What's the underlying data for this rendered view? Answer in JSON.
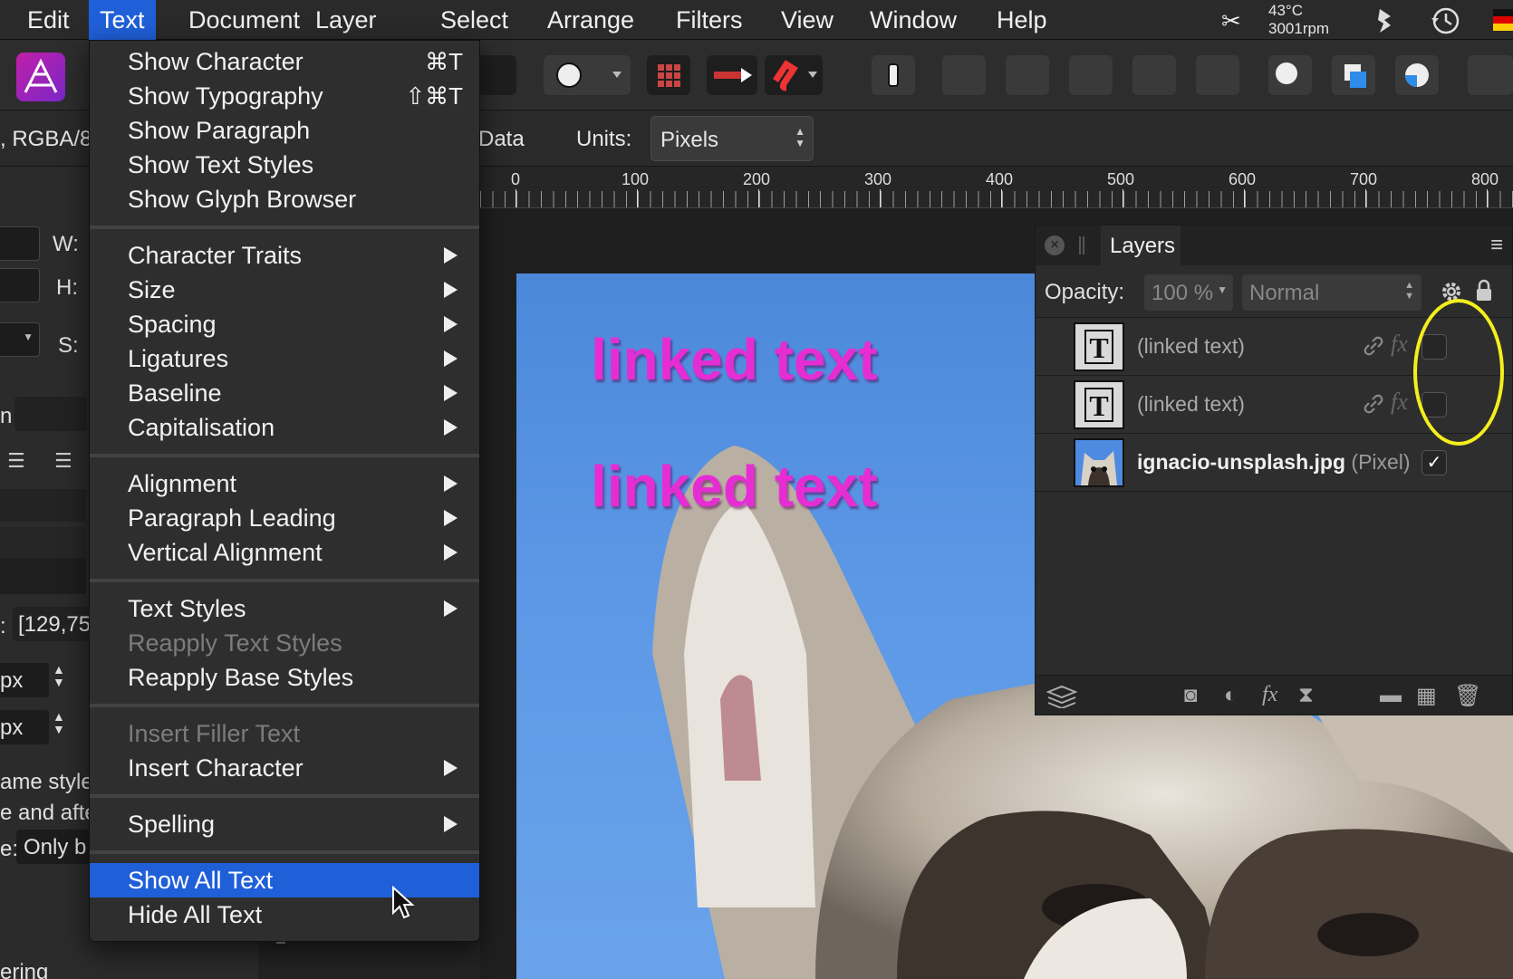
{
  "menubar": {
    "items": [
      "Edit",
      "Text",
      "Document",
      "Layer",
      "Select",
      "Arrange",
      "Filters",
      "View",
      "Window",
      "Help"
    ],
    "active": "Text",
    "temp": "43°C",
    "rpm": "3001rpm"
  },
  "contextbar": {
    "left_text": ", RGBA/8",
    "data_label": "Data",
    "units_label": "Units:",
    "units_value": "Pixels"
  },
  "ruler": {
    "labels": [
      "0",
      "100",
      "200",
      "300",
      "400",
      "500",
      "600",
      "700",
      "800"
    ]
  },
  "leftpanel": {
    "w_label": "W:",
    "h_label": "H:",
    "s_label": "S:",
    "n_label": "n",
    "coord_value": "[129,75",
    "coord_prefix": ":",
    "px1": "px",
    "px2": "px",
    "line1": "ame styles",
    "line2": "e and afte",
    "line3_prefix": "e:",
    "line3_value": "Only b",
    "bottom_text": "ering"
  },
  "text_menu": {
    "groups": [
      [
        {
          "label": "Show Character",
          "shortcut": "⌘T"
        },
        {
          "label": "Show Typography",
          "shortcut": "⇧⌘T"
        },
        {
          "label": "Show Paragraph"
        },
        {
          "label": "Show Text Styles"
        },
        {
          "label": "Show Glyph Browser"
        }
      ],
      [
        {
          "label": "Character Traits",
          "submenu": true
        },
        {
          "label": "Size",
          "submenu": true
        },
        {
          "label": "Spacing",
          "submenu": true
        },
        {
          "label": "Ligatures",
          "submenu": true
        },
        {
          "label": "Baseline",
          "submenu": true
        },
        {
          "label": "Capitalisation",
          "submenu": true
        }
      ],
      [
        {
          "label": "Alignment",
          "submenu": true
        },
        {
          "label": "Paragraph Leading",
          "submenu": true
        },
        {
          "label": "Vertical Alignment",
          "submenu": true
        }
      ],
      [
        {
          "label": "Text Styles",
          "submenu": true
        },
        {
          "label": "Reapply Text Styles",
          "disabled": true
        },
        {
          "label": "Reapply Base Styles"
        }
      ],
      [
        {
          "label": "Insert Filler Text",
          "disabled": true
        },
        {
          "label": "Insert Character",
          "submenu": true
        }
      ],
      [
        {
          "label": "Spelling",
          "submenu": true
        }
      ],
      [
        {
          "label": "Show All Text",
          "selected": true
        },
        {
          "label": "Hide All Text"
        }
      ]
    ]
  },
  "canvas": {
    "text1": "linked text",
    "text2": "linked text"
  },
  "layers_panel": {
    "tab": "Layers",
    "opacity_label": "Opacity:",
    "opacity_value": "100 %",
    "blend_mode": "Normal",
    "layers": [
      {
        "name": "(linked text)",
        "kind": "text",
        "visible": false
      },
      {
        "name": "(linked text)",
        "kind": "text",
        "visible": false
      },
      {
        "name": "ignacio-unsplash.jpg",
        "type": "(Pixel)",
        "kind": "pixel",
        "visible": true,
        "check": "✓"
      }
    ]
  },
  "colors": {
    "accent": "#1f5fd8",
    "text_magenta": "#e62dd4",
    "highlight": "#f4ee1d"
  }
}
